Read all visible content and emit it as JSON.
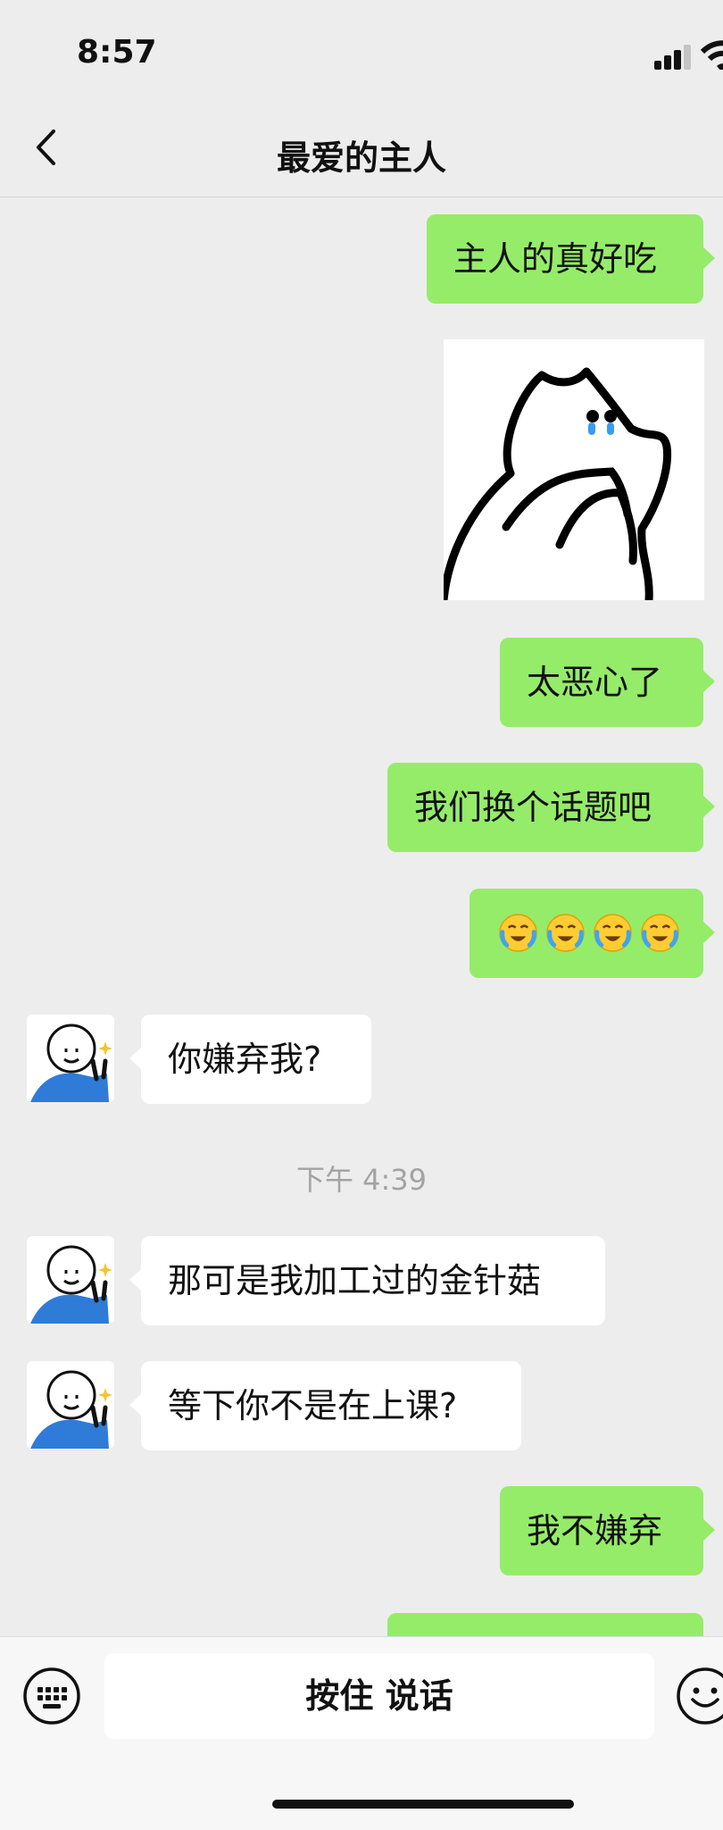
{
  "status_bar": {
    "time": "8:57"
  },
  "nav": {
    "title": "最爱的主人"
  },
  "messages": [
    {
      "text": "主人的真好吃"
    },
    {
      "text": "太恶心了"
    },
    {
      "text": "我们换个话题吧"
    },
    {
      "text": "你嫌弃我?"
    },
    {
      "text": "那可是我加工过的金针菇"
    },
    {
      "text": "等下你不是在上课?"
    },
    {
      "text": "我不嫌弃"
    }
  ],
  "timestamp": "下午 4:39",
  "emoji_message": [
    "loudly-crying-face",
    "loudly-crying-face",
    "loudly-crying-face",
    "loudly-crying-face"
  ],
  "input_bar": {
    "voice_label": "按住 说话"
  },
  "colors": {
    "outgoing_bubble": "#95ec69",
    "incoming_bubble": "#ffffff",
    "background": "#ededed"
  }
}
